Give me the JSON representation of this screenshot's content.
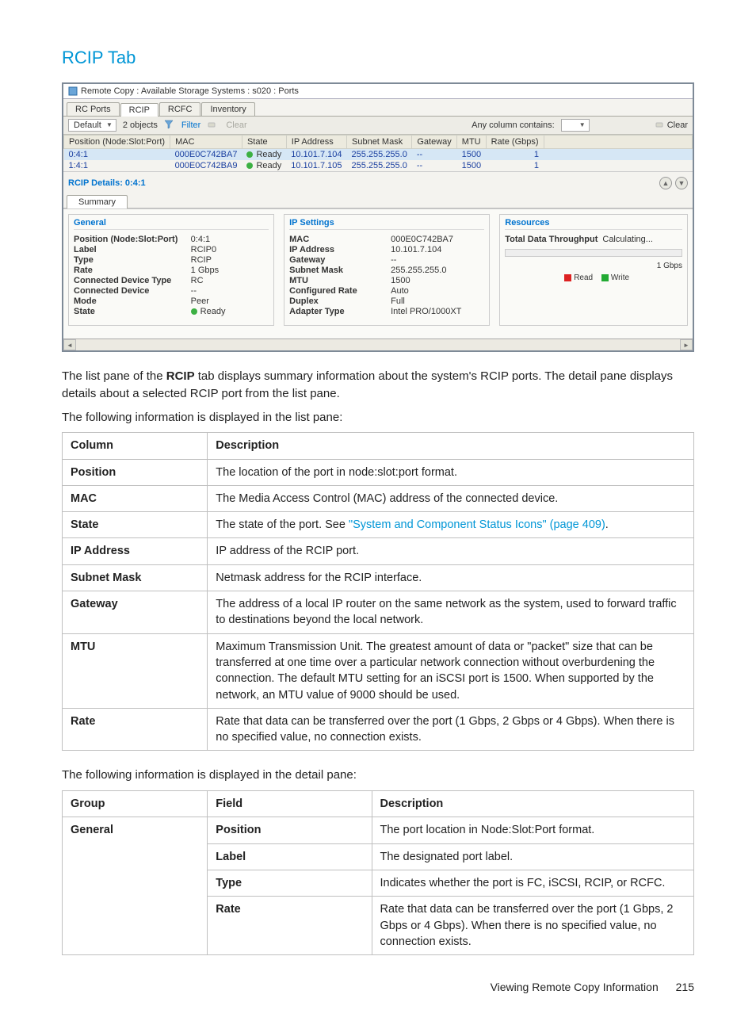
{
  "page": {
    "title": "RCIP Tab",
    "footer_label": "Viewing Remote Copy Information",
    "footer_page": "215"
  },
  "shot": {
    "window_title": "Remote Copy : Available Storage Systems : s020 : Ports",
    "tabs": [
      "RC Ports",
      "RCIP",
      "RCFC",
      "Inventory"
    ],
    "active_tab_index": 1,
    "toolbar": {
      "dropdown": "Default",
      "object_count": "2 objects",
      "filter_label": "Filter",
      "clear_left": "Clear",
      "any_column": "Any column contains:",
      "clear_right": "Clear"
    },
    "list_columns": [
      "Position (Node:Slot:Port)",
      "MAC",
      "State",
      "IP Address",
      "Subnet Mask",
      "Gateway",
      "MTU",
      "Rate (Gbps)"
    ],
    "list_rows": [
      {
        "values": [
          "0:4:1",
          "000E0C742BA7",
          "Ready",
          "10.101.7.104",
          "255.255.255.0",
          "--",
          "1500",
          "1"
        ],
        "selected": true
      },
      {
        "values": [
          "1:4:1",
          "000E0C742BA9",
          "Ready",
          "10.101.7.105",
          "255.255.255.0",
          "--",
          "1500",
          "1"
        ],
        "selected": false
      }
    ],
    "details_title": "RCIP Details: 0:4:1",
    "summary_tab": "Summary",
    "general": {
      "heading": "General",
      "rows": [
        {
          "k": "Position (Node:Slot:Port)",
          "v": "0:4:1"
        },
        {
          "k": "Label",
          "v": "RCIP0"
        },
        {
          "k": "Type",
          "v": "RCIP"
        },
        {
          "k": "Rate",
          "v": "1 Gbps"
        },
        {
          "k": "Connected Device Type",
          "v": "RC"
        },
        {
          "k": "Connected Device",
          "v": "--"
        },
        {
          "k": "Mode",
          "v": "Peer"
        },
        {
          "k": "State",
          "v": "Ready",
          "status": true
        }
      ]
    },
    "ip": {
      "heading": "IP Settings",
      "rows": [
        {
          "k": "MAC",
          "v": "000E0C742BA7"
        },
        {
          "k": "IP Address",
          "v": "10.101.7.104"
        },
        {
          "k": "Gateway",
          "v": "--"
        },
        {
          "k": "Subnet Mask",
          "v": "255.255.255.0"
        },
        {
          "k": "MTU",
          "v": "1500"
        },
        {
          "k": "Configured Rate",
          "v": "Auto"
        },
        {
          "k": "Duplex",
          "v": "Full"
        },
        {
          "k": "Adapter Type",
          "v": "Intel PRO/1000XT"
        }
      ]
    },
    "resources": {
      "heading": "Resources",
      "throughput_label": "Total Data Throughput",
      "throughput_value": "Calculating...",
      "scale": "1 Gbps",
      "legend_read": "Read",
      "legend_write": "Write"
    }
  },
  "body_text": {
    "p1a": "The list pane of the ",
    "p1bold": "RCIP",
    "p1b": " tab displays summary information about the system's RCIP ports. The detail pane displays details about a selected RCIP port from the list pane.",
    "p2": "The following information is displayed in the list pane:",
    "p3": "The following information is displayed in the detail pane:"
  },
  "list_desc": {
    "headers": [
      "Column",
      "Description"
    ],
    "rows": [
      {
        "c": "Position",
        "d": "The location of the port in node:slot:port format."
      },
      {
        "c": "MAC",
        "d": "The Media Access Control (MAC) address of the connected device."
      },
      {
        "c": "State",
        "d_pre": "The state of the port. See ",
        "link": "\"System and Component Status Icons\" (page 409)",
        "d_post": "."
      },
      {
        "c": "IP Address",
        "d": "IP address of the RCIP port."
      },
      {
        "c": "Subnet Mask",
        "d": "Netmask address for the RCIP interface."
      },
      {
        "c": "Gateway",
        "d": "The address of a local IP router on the same network as the system, used to forward traffic to destinations beyond the local network."
      },
      {
        "c": "MTU",
        "d": "Maximum Transmission Unit. The greatest amount of data or \"packet\" size that can be transferred at one time over a particular network connection without overburdening the connection. The default MTU setting for an iSCSI port is 1500. When supported by the network, an MTU value of 9000 should be used."
      },
      {
        "c": "Rate",
        "d": "Rate that data can be transferred over the port (1 Gbps, 2 Gbps or 4 Gbps). When there is no specified value, no connection exists."
      }
    ]
  },
  "detail_desc": {
    "headers": [
      "Group",
      "Field",
      "Description"
    ],
    "group": "General",
    "rows": [
      {
        "f": "Position",
        "d": "The port location in Node:Slot:Port format."
      },
      {
        "f": "Label",
        "d": "The designated port label."
      },
      {
        "f": "Type",
        "d": "Indicates whether the port is FC, iSCSI, RCIP, or RCFC."
      },
      {
        "f": "Rate",
        "d": "Rate that data can be transferred over the port (1 Gbps, 2 Gbps or 4 Gbps). When there is no specified value, no connection exists."
      }
    ]
  }
}
